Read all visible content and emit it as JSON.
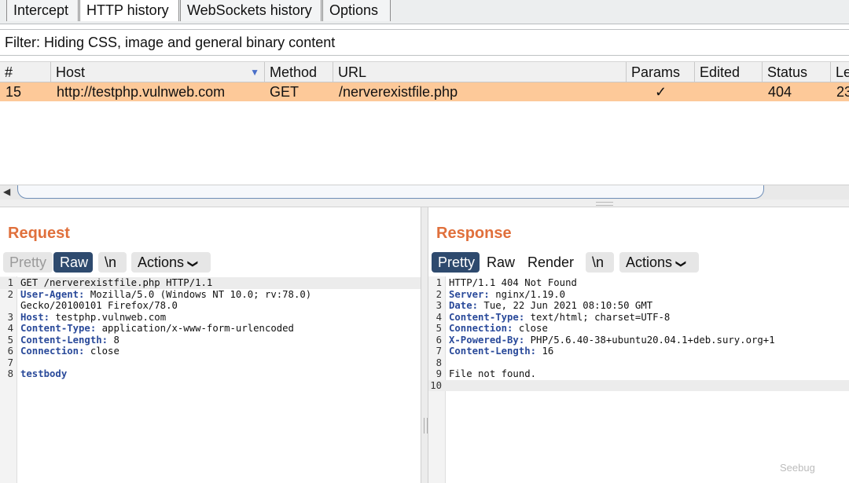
{
  "tabs": [
    "Intercept",
    "HTTP history",
    "WebSockets history",
    "Options"
  ],
  "active_tab": "HTTP history",
  "filter_text": "Filter: Hiding CSS, image and general binary content",
  "table": {
    "columns": [
      "#",
      "Host",
      "Method",
      "URL",
      "Params",
      "Edited",
      "Status",
      "Le"
    ],
    "sorted_column": "Host",
    "rows": [
      {
        "num": "15",
        "host": "http://testphp.vulnweb.com",
        "method": "GET",
        "url": "/nerverexistfile.php",
        "params": "✓",
        "edited": "",
        "status": "404",
        "length": "23"
      }
    ],
    "selected_row_color": "#fdc999"
  },
  "request": {
    "title": "Request",
    "buttons": {
      "pretty": "Pretty",
      "raw": "Raw",
      "newline": "\\n",
      "actions": "Actions"
    },
    "selected_view": "Raw",
    "lines": [
      {
        "n": "1",
        "header": "",
        "text": "GET /nerverexistfile.php HTTP/1.1"
      },
      {
        "n": "2",
        "header": "User-Agent:",
        "text": " Mozilla/5.0 (Windows NT 10.0; rv:78.0)"
      },
      {
        "n": "",
        "header": "",
        "text": "Gecko/20100101 Firefox/78.0"
      },
      {
        "n": "3",
        "header": "Host:",
        "text": " testphp.vulnweb.com"
      },
      {
        "n": "4",
        "header": "Content-Type:",
        "text": " application/x-www-form-urlencoded"
      },
      {
        "n": "5",
        "header": "Content-Length:",
        "text": " 8"
      },
      {
        "n": "6",
        "header": "Connection:",
        "text": " close"
      },
      {
        "n": "7",
        "header": "",
        "text": ""
      },
      {
        "n": "8",
        "header": "testbody",
        "text": ""
      }
    ]
  },
  "response": {
    "title": "Response",
    "buttons": {
      "pretty": "Pretty",
      "raw": "Raw",
      "render": "Render",
      "newline": "\\n",
      "actions": "Actions"
    },
    "selected_view": "Pretty",
    "lines": [
      {
        "n": "1",
        "header": "",
        "text": "HTTP/1.1 404 Not Found"
      },
      {
        "n": "2",
        "header": "Server:",
        "text": " nginx/1.19.0"
      },
      {
        "n": "3",
        "header": "Date:",
        "text": " Tue, 22 Jun 2021 08:10:50 GMT"
      },
      {
        "n": "4",
        "header": "Content-Type:",
        "text": " text/html; charset=UTF-8"
      },
      {
        "n": "5",
        "header": "Connection:",
        "text": " close"
      },
      {
        "n": "6",
        "header": "X-Powered-By:",
        "text": " PHP/5.6.40-38+ubuntu20.04.1+deb.sury.org+1"
      },
      {
        "n": "7",
        "header": "Content-Length:",
        "text": " 16"
      },
      {
        "n": "8",
        "header": "",
        "text": ""
      },
      {
        "n": "9",
        "header": "",
        "text": "File not found."
      },
      {
        "n": "10",
        "header": "",
        "text": ""
      }
    ]
  },
  "layout_toggle_icons": [
    "split-horizontal-icon",
    "split-vertical-icon",
    "single-pane-icon"
  ],
  "watermark": "Seebug",
  "colors": {
    "accent": "#e0703c",
    "selected_button": "#2e4a6e",
    "header_key": "#2a4a9a"
  }
}
